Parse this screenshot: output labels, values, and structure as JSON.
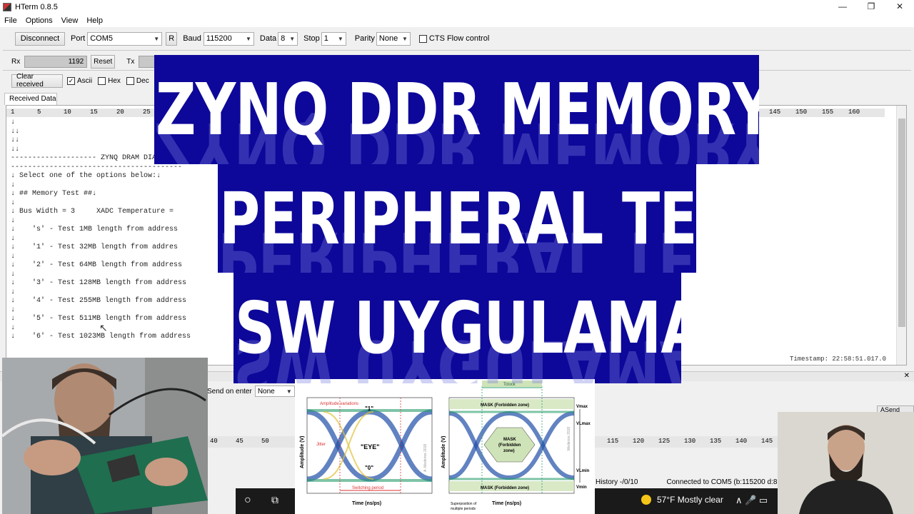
{
  "window": {
    "title": "HTerm 0.8.5",
    "minimize": "—",
    "restore": "❐",
    "close": "✕"
  },
  "menu": [
    "File",
    "Options",
    "View",
    "Help"
  ],
  "connection": {
    "disconnect_label": "Disconnect",
    "port_label": "Port",
    "port_value": "COM5",
    "refresh_label": "R",
    "baud_label": "Baud",
    "baud_value": "115200",
    "data_label": "Data",
    "data_value": "8",
    "stop_label": "Stop",
    "stop_value": "1",
    "parity_label": "Parity",
    "parity_value": "None",
    "cts_label": "CTS Flow control"
  },
  "counters": {
    "rx_label": "Rx",
    "rx_value": "1192",
    "reset_label": "Reset",
    "tx_label": "Tx"
  },
  "input_control": {
    "clear_label": "Clear received",
    "ascii_label": "Ascii",
    "hex_label": "Hex",
    "dec_label": "Dec"
  },
  "received": {
    "tab_label": "Received Data",
    "ruler_left": [
      "1",
      "5",
      "10",
      "15",
      "20",
      "25"
    ],
    "ruler_right": [
      "145",
      "150",
      "155",
      "160"
    ],
    "lines": [
      "↓",
      "↓↓",
      "↓↓",
      "↓↓",
      "-------------------- ZYNQ DRAM DIAGNOSTI",
      "----------------------------------------",
      "↓ Select one of the options below:↓",
      "↓",
      "↓ ## Memory Test ##↓",
      "↓",
      "↓ Bus Width = 3     XADC Temperature = ",
      "↓",
      "↓    's' - Test 1MB length from address",
      "↓",
      "↓    '1' - Test 32MB length from addres",
      "↓",
      "↓    '2' - Test 64MB length from address",
      "↓",
      "↓    '3' - Test 128MB length from address",
      "↓",
      "↓    '4' - Test 255MB length from address",
      "↓",
      "↓    '5' - Test 511MB length from address",
      "↓",
      "↓    '6' - Test 1023MB length from address"
    ],
    "timestamp": "Timestamp: 22:58:51.017.0"
  },
  "send": {
    "send_on_enter_label": "Send on enter",
    "send_on_enter_value": "None",
    "asend_label": "ASend"
  },
  "transmit_ruler": [
    "40",
    "45",
    "50",
    "115",
    "120",
    "125",
    "130",
    "135",
    "140",
    "145"
  ],
  "status": {
    "history": "History -/0/10",
    "connection": "Connected to COM5 (b:115200 d:8"
  },
  "taskbar": {
    "weather": "57°F  Mostly clear"
  },
  "overlay": {
    "line1": "ZYNQ DDR MEMORY VE",
    "line2": "PERIPHERAL TEST",
    "line3": "SW UYGULAMASI"
  },
  "eye_diagram": {
    "left": {
      "amplitude_variations": "Amplitude variations",
      "one": "\"1\"",
      "zero": "\"0\"",
      "eye": "\"EYE\"",
      "jitter": "Jitter",
      "switching_period": "Switching period",
      "ylabel": "Amplitude (V)",
      "xlabel": "Time (ns/ps)",
      "watermark": "A. Medeiros 2018"
    },
    "right": {
      "tclock": "Tclock",
      "mask_top": "MASK (Forbidden zone)",
      "mask_mid_1": "MASK",
      "mask_mid_2": "(Forbidden",
      "mask_mid_3": "zone)",
      "mask_bottom": "MASK (Forbidden zone)",
      "vmax": "Vmax",
      "vlmax": "VLmax",
      "vlmin": "VLmin",
      "vmin": "Vmin",
      "ylabel": "Amplitude (V)",
      "xlabel": "Time (ns/ps)",
      "superposition_1": "Superposition of",
      "superposition_2": "multiple periods",
      "watermark": "Medeiros 2018"
    }
  }
}
